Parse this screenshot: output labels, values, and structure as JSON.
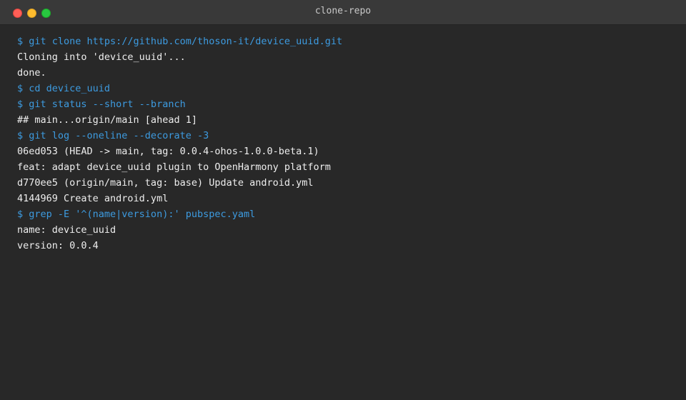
{
  "window": {
    "title": "clone-repo"
  },
  "colors": {
    "background": "#282828",
    "titlebar": "#393939",
    "command": "#3d9be0",
    "output": "#eeeeee"
  },
  "terminal": {
    "lines": [
      {
        "type": "cmd",
        "text": "$ git clone https://github.com/thoson-it/device_uuid.git"
      },
      {
        "type": "out",
        "text": "Cloning into 'device_uuid'..."
      },
      {
        "type": "out",
        "text": "done."
      },
      {
        "type": "cmd",
        "text": "$ cd device_uuid"
      },
      {
        "type": "cmd",
        "text": "$ git status --short --branch"
      },
      {
        "type": "out",
        "text": "## main...origin/main [ahead 1]"
      },
      {
        "type": "cmd",
        "text": "$ git log --oneline --decorate -3"
      },
      {
        "type": "out",
        "text": "06ed053 (HEAD -> main, tag: 0.0.4-ohos-1.0.0-beta.1)"
      },
      {
        "type": "out",
        "text": "feat: adapt device_uuid plugin to OpenHarmony platform"
      },
      {
        "type": "out",
        "text": "d770ee5 (origin/main, tag: base) Update android.yml"
      },
      {
        "type": "out",
        "text": "4144969 Create android.yml"
      },
      {
        "type": "cmd",
        "text": "$ grep -E '^(name|version):' pubspec.yaml"
      },
      {
        "type": "out",
        "text": "name: device_uuid"
      },
      {
        "type": "out",
        "text": "version: 0.0.4"
      }
    ]
  }
}
